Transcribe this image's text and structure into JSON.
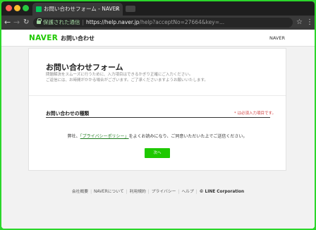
{
  "browser": {
    "tab_title": "お問い合わせフォーム - NAVER",
    "tab_close": "×",
    "security_label": "保護された通信",
    "url_host": "https://help.naver.jp",
    "url_rest": "/help?acceptNo=27664&key=...",
    "back_glyph": "←",
    "forward_glyph": "→",
    "reload_glyph": "↻",
    "star_glyph": "☆",
    "menu_glyph": "⋮"
  },
  "header": {
    "logo": "NAVER",
    "service_name": "お問い合わせ",
    "right_label": "NAVER"
  },
  "form": {
    "title": "お問い合わせフォーム",
    "description_line1": "問題解決をスムーズに行うために、入力項目はできるかぎり正確にご入力ください。",
    "description_line2": "ご返信には、お時間がかかる場合がございます。ご了承くださいますようお願いいたします。",
    "section_label": "お問い合わせの種類",
    "required_note": "* は必須入力項目です。",
    "agree_prefix": "弊社、",
    "policy_link": "「プライバシーポリシー」",
    "agree_suffix": "をよくお読みになり、ご同意いただいた上でご送信ください。",
    "next_button": "次へ"
  },
  "footer": {
    "links": [
      "会社概要",
      "NAVERについて",
      "利用規約",
      "プライバシー",
      "ヘルプ"
    ],
    "corp": "© LINE Corporation"
  }
}
